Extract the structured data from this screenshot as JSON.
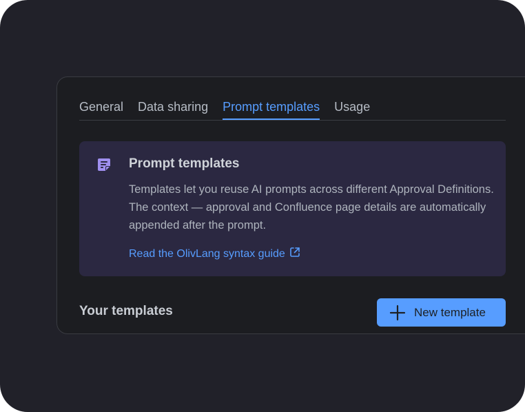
{
  "tabs": [
    {
      "label": "General",
      "active": false
    },
    {
      "label": "Data sharing",
      "active": false
    },
    {
      "label": "Prompt templates",
      "active": true
    },
    {
      "label": "Usage",
      "active": false
    }
  ],
  "info_panel": {
    "icon": "note-icon",
    "title": "Prompt templates",
    "body": "Templates let you reuse AI prompts across different Approval Definitions. The context — approval and Confluence page details are automatically appended after the prompt.",
    "link_label": "Read the OlivLang syntax guide",
    "link_icon": "external-link-icon"
  },
  "templates_section": {
    "title": "Your templates",
    "new_button_label": "New template",
    "new_button_icon": "plus-icon"
  },
  "colors": {
    "outer_bg": "#212129",
    "panel_bg": "#1c1d21",
    "info_bg": "#2b2841",
    "accent": "#579dff",
    "icon_purple": "#9f8fef"
  }
}
